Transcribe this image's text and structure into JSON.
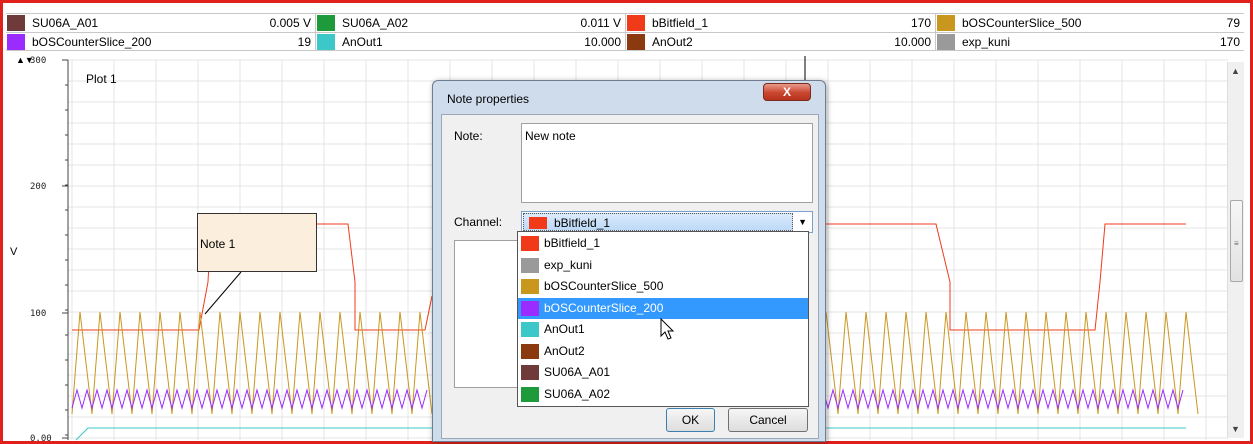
{
  "legend": {
    "row1": [
      {
        "name": "SU06A_A01",
        "value": "0.005  V",
        "color": "#6e3a3a"
      },
      {
        "name": "SU06A_A02",
        "value": "0.011  V",
        "color": "#1e9a3a"
      },
      {
        "name": "bBitfield_1",
        "value": "170",
        "color": "#f03a1a"
      },
      {
        "name": "bOSCounterSlice_500",
        "value": "79",
        "color": "#c9961e"
      }
    ],
    "row2": [
      {
        "name": "bOSCounterSlice_200",
        "value": "19",
        "color": "#9b2cff"
      },
      {
        "name": "AnOut1",
        "value": "10.000",
        "color": "#3cc8c8"
      },
      {
        "name": "AnOut2",
        "value": "10.000",
        "color": "#8b3a10"
      },
      {
        "name": "exp_kuni",
        "value": "170",
        "color": "#9a9a9a"
      }
    ]
  },
  "plot": {
    "title": "Plot 1",
    "y_unit": "V",
    "y_ticks": [
      "300",
      "200",
      "100",
      "0.00"
    ]
  },
  "note": {
    "text": "Note 1"
  },
  "dialog": {
    "title": "Note properties",
    "close_label": "X",
    "note_label": "Note:",
    "note_value": "New note",
    "channel_label": "Channel:",
    "channel_selected": "bBitfield_1",
    "channel_selected_color": "#f03a1a",
    "ok_label": "OK",
    "cancel_label": "Cancel",
    "options": [
      {
        "name": "bBitfield_1",
        "color": "#f03a1a"
      },
      {
        "name": "exp_kuni",
        "color": "#9a9a9a"
      },
      {
        "name": "bOSCounterSlice_500",
        "color": "#c9961e"
      },
      {
        "name": "bOSCounterSlice_200",
        "color": "#9b2cff",
        "highlighted": true
      },
      {
        "name": "AnOut1",
        "color": "#3cc8c8"
      },
      {
        "name": "AnOut2",
        "color": "#8b3a10"
      },
      {
        "name": "SU06A_A01",
        "color": "#6e3a3a"
      },
      {
        "name": "SU06A_A02",
        "color": "#1e9a3a"
      }
    ]
  },
  "series_colors": {
    "bitfield": "#f03a1a",
    "counter_500": "#c9961e",
    "counter_200": "#9b2cff",
    "anout1": "#3cc8c8",
    "grid": "#e4e4e4"
  }
}
